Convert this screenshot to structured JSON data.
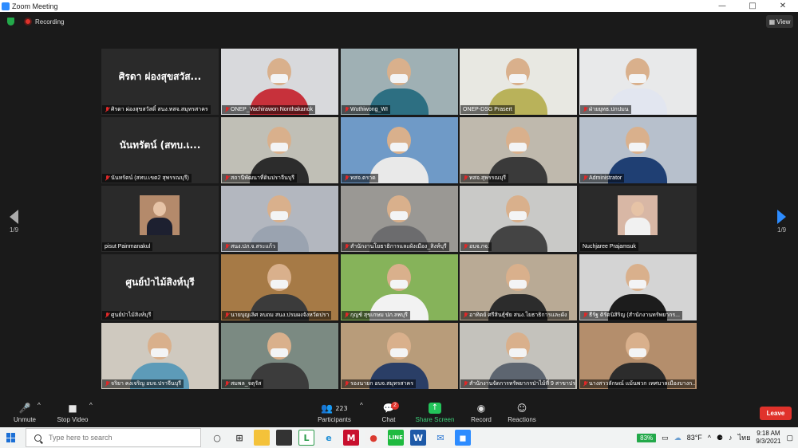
{
  "window": {
    "title": "Zoom Meeting",
    "controls": [
      "—",
      "□",
      "✕"
    ]
  },
  "topbar": {
    "recording_label": "Recording",
    "view_label": "View"
  },
  "pager": {
    "left": "1/9",
    "right": "1/9"
  },
  "tiles": [
    {
      "name": "ศิรดา ผ่องสุขสวัสดิ์ สนง.ทสจ.สมุทรสาคร",
      "display": "ศิรดา ผ่องสุขสวัส...",
      "muted": true,
      "video": false
    },
    {
      "name": "ONEP_Vachirawon Nonthakanok",
      "muted": true,
      "video": true,
      "bg": "#d8d9dc",
      "shirt": "#c7313b"
    },
    {
      "name": "Wuthiwong_WI",
      "muted": true,
      "video": true,
      "bg": "#9fb0b4",
      "shirt": "#2d6f82"
    },
    {
      "name": "ONEP-DSG Prasert",
      "muted": false,
      "video": true,
      "active": true,
      "bg": "#e8e8e2",
      "shirt": "#b9b25a"
    },
    {
      "name": "ฝ่ายยุทธ.ปกปมน",
      "muted": true,
      "video": true,
      "bg": "#e8e9ea",
      "shirt": "#e2e6f0"
    },
    {
      "name": "นันทรัตน์ (สทบ.เขต2 สุพรรณบุรี)",
      "display": "นันทรัตน์ (สทบ.เ...",
      "muted": true,
      "video": false
    },
    {
      "name": "สถานีพัฒนาที่ดินปราจีนบุรี",
      "muted": true,
      "video": true,
      "bg": "#c0bfb6",
      "shirt": "#2c2c2c"
    },
    {
      "name": "ทสจ.ตราด",
      "muted": true,
      "video": true,
      "bg": "#6f9ac7",
      "shirt": "#e9e9e9"
    },
    {
      "name": "ทสจ.สุพรรณบุรี",
      "muted": true,
      "video": true,
      "bg": "#bfb9ad",
      "shirt": "#3a3a3a"
    },
    {
      "name": "Administrator",
      "muted": true,
      "video": true,
      "bg": "#b7c0cc",
      "shirt": "#1f3f73"
    },
    {
      "name": "pisut Painmanakul",
      "muted": false,
      "video": true,
      "small": true,
      "bg": "#b48a6b",
      "shirt": "#1d2030"
    },
    {
      "name": "สนง.ปภ.จ.สระแก้ว",
      "muted": true,
      "video": true,
      "bg": "#b3b7bf",
      "shirt": "#9aa3b0"
    },
    {
      "name": "สำนักงานโยธาธิการและผังเมือง_สิงห์บุรี",
      "muted": true,
      "video": true,
      "bg": "#9a9894",
      "shirt": "#6c6c6e"
    },
    {
      "name": "อบจ.กจ.",
      "muted": true,
      "video": true,
      "bg": "#c9c9c7",
      "shirt": "#444"
    },
    {
      "name": "Nuchjaree Prajamsuk",
      "muted": false,
      "video": true,
      "small": true,
      "bg": "#d8b7a5",
      "shirt": "#f1f1f1"
    },
    {
      "name": "ศูนย์ป่าไม้สิงห์บุรี",
      "display": "ศูนย์ป่าไม้สิงห์บุรี",
      "muted": true,
      "video": false
    },
    {
      "name": "นายบุญเลิศ ลบถม สนง.ปรมผงจังหวัดปรา",
      "muted": true,
      "video": true,
      "bg": "#a67a46",
      "shirt": "#3b3b3b"
    },
    {
      "name": "กุญช์ สุขเกษม ปภ.ลพบุรี",
      "muted": true,
      "video": true,
      "bg": "#86b35a",
      "shirt": "#f2f2f2"
    },
    {
      "name": "อาทิตย์ ศรีสินธุ์ชัย สนง.โยธาธิการและผัง",
      "muted": true,
      "video": true,
      "bg": "#b9aa95",
      "shirt": "#2c2c2c"
    },
    {
      "name": "ธีรัฐ ติรัตนิสิริญ (สำนักงานทรัพยากร...",
      "muted": true,
      "video": true,
      "bg": "#d4d4d4",
      "shirt": "#1c1c1c"
    },
    {
      "name": "จริยา คงเจริญ อบจ.ปราจีนบุรี",
      "muted": true,
      "video": true,
      "bg": "#cfc9bf",
      "shirt": "#5d9bb8"
    },
    {
      "name": "สมพล_จตุรัส",
      "muted": true,
      "video": true,
      "bg": "#7b8a82",
      "shirt": "#3c3c3c"
    },
    {
      "name": "รองนายก อบจ.สมุทรสาคร",
      "muted": true,
      "video": true,
      "bg": "#b89c7a",
      "shirt": "#2a3e66"
    },
    {
      "name": "สำนักงานจัดการทรัพยากรป่าไม้ที่ 9 สาขาปร...",
      "muted": true,
      "video": true,
      "bg": "#c4c2bc",
      "shirt": "#5d6570"
    },
    {
      "name": "นางสาวลักษณ์ แม้นพวก เทศบาลเมืองบางก...",
      "muted": true,
      "video": true,
      "bg": "#b48e6c",
      "shirt": "#2c2c2c"
    }
  ],
  "toolbar": {
    "unmute": "Unmute",
    "stop_video": "Stop Video",
    "participants": "Participants",
    "participants_count": "223",
    "chat": "Chat",
    "chat_badge": "2",
    "share_screen": "Share Screen",
    "record": "Record",
    "reactions": "Reactions",
    "leave": "Leave"
  },
  "taskbar": {
    "search_placeholder": "Type here to search",
    "battery": "83%",
    "temperature": "83°F",
    "language": "ไทย",
    "time": "9:18 AM",
    "date": "9/3/2021"
  },
  "colors": {
    "accent": "#2d8cff",
    "leave": "#e0322b",
    "share": "#23c45a",
    "active_speaker": "#c8e346"
  }
}
